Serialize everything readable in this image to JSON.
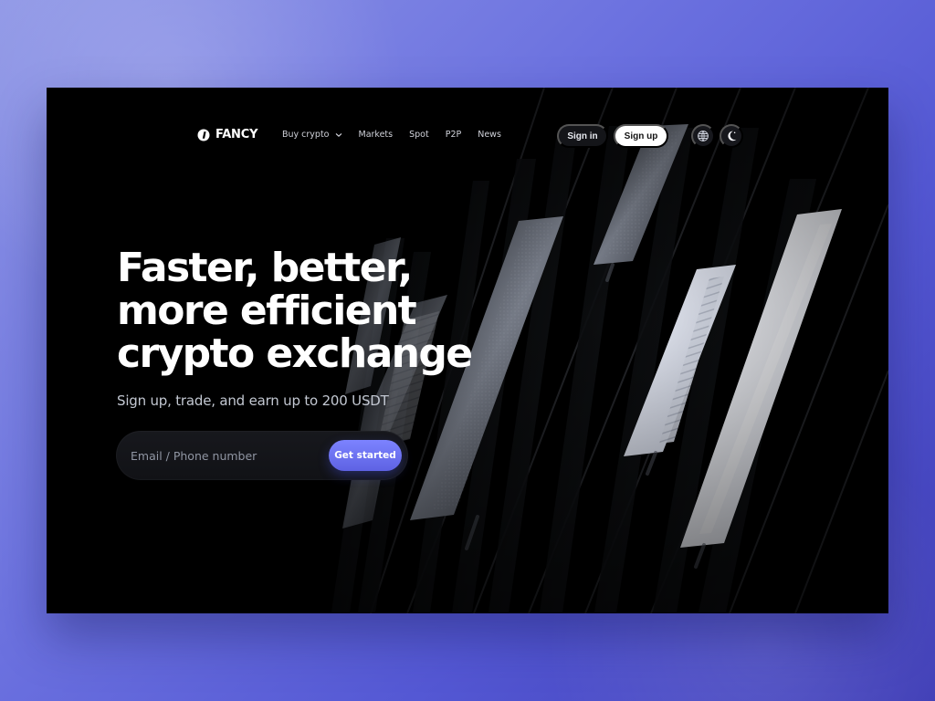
{
  "brand": {
    "name": "FANCY",
    "logo_icon": "logo-mark-icon"
  },
  "nav": {
    "buy_crypto": "Buy crypto",
    "markets": "Markets",
    "spot": "Spot",
    "p2p": "P2P",
    "news": "News",
    "buy_crypto_dropdown_icon": "chevron-down-icon"
  },
  "actions": {
    "sign_in": "Sign in",
    "sign_up": "Sign up",
    "language_icon": "globe-icon",
    "theme_icon": "moon-icon"
  },
  "hero": {
    "title_lines": [
      "Faster, better,",
      "more efficient",
      "crypto exchange"
    ],
    "subtitle": "Sign up, trade, and earn up to 200 USDT"
  },
  "form": {
    "placeholder": "Email / Phone number",
    "value": "",
    "submit": "Get started"
  },
  "colors": {
    "accent": "#6f74f2",
    "page_gradient_start": "#8f97e6",
    "page_gradient_end": "#3f3db6",
    "frame_background": "#000000",
    "light_panel": "#d9dce6"
  }
}
